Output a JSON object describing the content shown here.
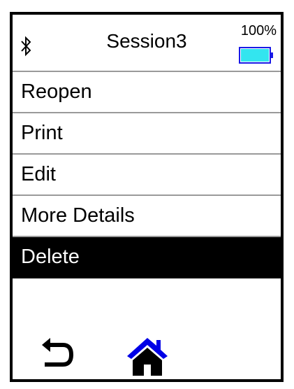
{
  "header": {
    "title": "Session3",
    "battery_percent": "100%",
    "battery_level": 1.0,
    "battery_color": "#33e5ef",
    "battery_outline_color": "#1a1ae6",
    "bluetooth_icon": "bluetooth-icon"
  },
  "menu": {
    "items": [
      {
        "label": "Reopen",
        "selected": false
      },
      {
        "label": "Print",
        "selected": false
      },
      {
        "label": "Edit",
        "selected": false
      },
      {
        "label": "More Details",
        "selected": false
      },
      {
        "label": "Delete",
        "selected": true
      }
    ]
  },
  "footer": {
    "back_icon": "back-arrow-icon",
    "home_icon": "home-icon",
    "home_color": "#0000e6"
  }
}
